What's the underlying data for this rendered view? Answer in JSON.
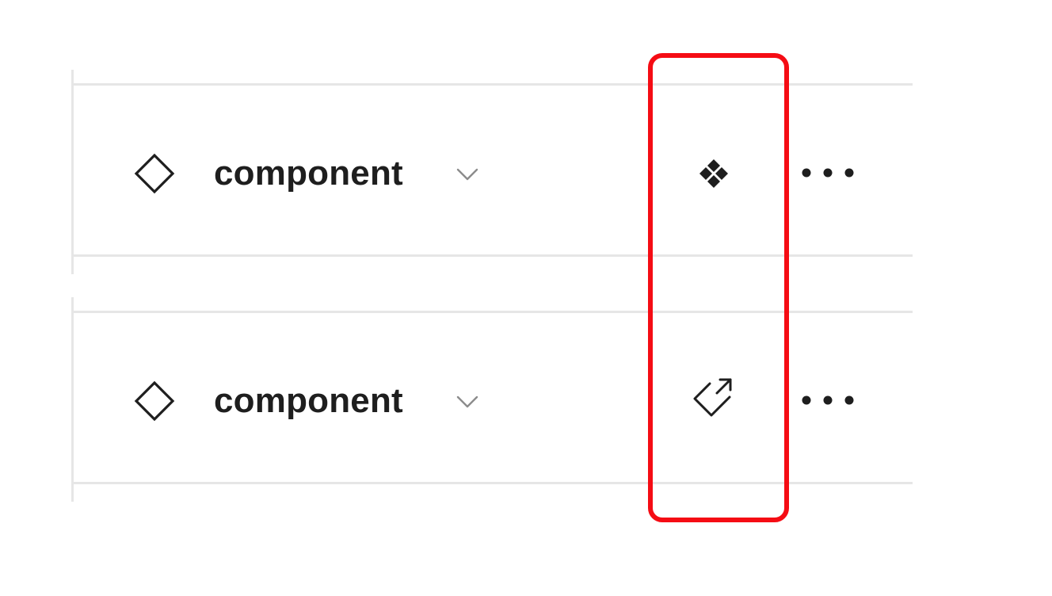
{
  "rows": [
    {
      "name": "component",
      "type_icon": "diamond-outline-icon",
      "dropdown_icon": "chevron-down-icon",
      "action_icon": "component-instance-icon",
      "more_icon": "more-horizontal-icon"
    },
    {
      "name": "component",
      "type_icon": "diamond-outline-icon",
      "dropdown_icon": "chevron-down-icon",
      "action_icon": "go-to-main-component-icon",
      "more_icon": "more-horizontal-icon"
    }
  ],
  "colors": {
    "text": "#1e1e1e",
    "divider": "#e6e6e6",
    "chevron": "#8c8c8c",
    "highlight": "#f50c14"
  }
}
